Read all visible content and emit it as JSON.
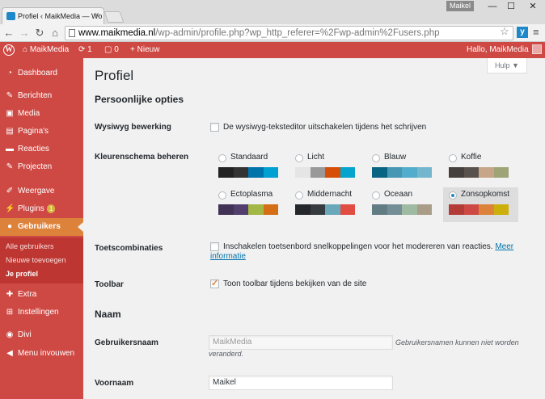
{
  "browser": {
    "tab_title": "Profiel ‹ MaikMedia — Wo",
    "tab_close": "×",
    "user_name": "Maikel",
    "window_buttons": [
      "—",
      "☐",
      "✕"
    ],
    "url_host": "www.maikmedia.nl",
    "url_path": "/wp-admin/profile.php?wp_http_referer=%2Fwp-admin%2Fusers.php",
    "extension_label": "y"
  },
  "adminbar": {
    "logo": "W",
    "site_name": "MaikMedia",
    "updates_count": "1",
    "comments_count": "0",
    "new_label": "Nieuw",
    "greeting": "Hallo, MaikMedia"
  },
  "sidebar": {
    "items": [
      {
        "label": "Dashboard",
        "icon": "dashboard-icon"
      },
      {
        "label": "Berichten",
        "icon": "pin-icon"
      },
      {
        "label": "Media",
        "icon": "media-icon"
      },
      {
        "label": "Pagina's",
        "icon": "pages-icon"
      },
      {
        "label": "Reacties",
        "icon": "comments-icon"
      },
      {
        "label": "Projecten",
        "icon": "pin-icon"
      },
      {
        "label": "Weergave",
        "icon": "brush-icon"
      },
      {
        "label": "Plugins",
        "icon": "plugin-icon",
        "badge": "1"
      },
      {
        "label": "Gebruikers",
        "icon": "users-icon"
      },
      {
        "label": "Extra",
        "icon": "tools-icon"
      },
      {
        "label": "Instellingen",
        "icon": "settings-icon"
      },
      {
        "label": "Divi",
        "icon": "divi-icon"
      },
      {
        "label": "Menu invouwen",
        "icon": "collapse-icon"
      }
    ],
    "submenu": [
      "Alle gebruikers",
      "Nieuwe toevoegen",
      "Je profiel"
    ]
  },
  "main": {
    "help_label": "Hulp ▼",
    "page_title": "Profiel",
    "section_personal": "Persoonlijke opties",
    "wysiwyg_label": "Wysiwyg bewerking",
    "wysiwyg_text": "De wysiwyg-teksteditor uitschakelen tijdens het schrijven",
    "scheme_label": "Kleurenschema beheren",
    "schemes": [
      {
        "name": "Standaard",
        "colors": [
          "#222222",
          "#333333",
          "#0073aa",
          "#00a0d2"
        ]
      },
      {
        "name": "Licht",
        "colors": [
          "#e5e5e5",
          "#999999",
          "#d64e07",
          "#04a4cc"
        ]
      },
      {
        "name": "Blauw",
        "colors": [
          "#096484",
          "#4796b3",
          "#52accc",
          "#74b6ce"
        ]
      },
      {
        "name": "Koffie",
        "colors": [
          "#46403c",
          "#59524c",
          "#c7a589",
          "#9ea476"
        ]
      },
      {
        "name": "Ectoplasma",
        "colors": [
          "#413256",
          "#523f6d",
          "#a3b745",
          "#d46f15"
        ]
      },
      {
        "name": "Middernacht",
        "colors": [
          "#25282b",
          "#363b3f",
          "#69a8bb",
          "#e14d43"
        ]
      },
      {
        "name": "Oceaan",
        "colors": [
          "#627c83",
          "#738e96",
          "#9ebaa0",
          "#aa9d88"
        ]
      },
      {
        "name": "Zonsopkomst",
        "colors": [
          "#b43c38",
          "#cf4944",
          "#dd823b",
          "#ccaf0b"
        ],
        "selected": true
      }
    ],
    "shortcuts_label": "Toetscombinaties",
    "shortcuts_text": "Inschakelen toetsenbord snelkoppelingen voor het modereren van reacties.",
    "shortcuts_link_1": "Meer",
    "shortcuts_link_2": "informatie",
    "toolbar_label": "Toolbar",
    "toolbar_text": "Toon toolbar tijdens bekijken van de site",
    "section_name": "Naam",
    "username_label": "Gebruikersnaam",
    "username_value": "MaikMedia",
    "username_desc_1": "Gebruikersnamen kunnen niet worden",
    "username_desc_2": "veranderd.",
    "firstname_label": "Voornaam",
    "firstname_value": "Maikel"
  }
}
